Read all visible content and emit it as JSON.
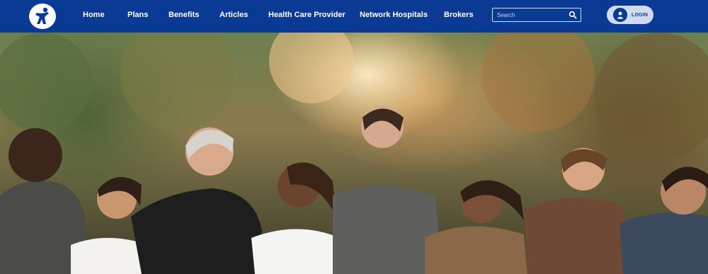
{
  "nav": {
    "links": [
      {
        "label": "Home"
      },
      {
        "label": "Plans"
      },
      {
        "label": "Benefits"
      },
      {
        "label": "Articles"
      },
      {
        "label": "Health Care Provider"
      },
      {
        "label": "Network Hospitals"
      },
      {
        "label": "Brokers"
      }
    ],
    "search_placeholder": "Search",
    "login_label": "LOGIN"
  },
  "colors": {
    "nav_bg": "#0b3a94",
    "login_bg": "#cfdbf3",
    "white": "#ffffff"
  },
  "icons": {
    "logo": "brand-logo-icon",
    "search": "search-icon",
    "user": "user-icon"
  },
  "hero": {
    "image": "group-of-diverse-people-outdoors-photo"
  }
}
